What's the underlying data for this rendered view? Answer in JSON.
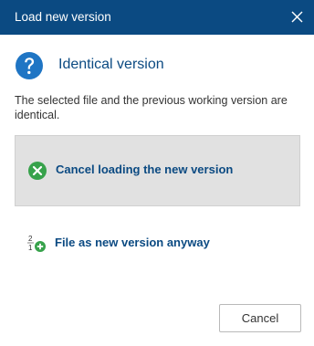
{
  "window": {
    "title": "Load new version",
    "close_icon": "close-icon"
  },
  "header": {
    "icon": "question-icon",
    "title": "Identical version"
  },
  "message": "The selected file and the previous working version are identical.",
  "options": [
    {
      "icon": "cancel-circle-icon",
      "label": "Cancel loading the new version",
      "selected": true
    },
    {
      "icon": "new-version-icon",
      "label": "File as new version anyway",
      "selected": false
    }
  ],
  "footer": {
    "cancel_label": "Cancel"
  },
  "colors": {
    "title_bar": "#0b4a82",
    "accent_text": "#0b4a82",
    "question_icon": "#1f75c4",
    "cancel_icon": "#37a24b",
    "selected_option_bg": "#e1e1e1"
  }
}
